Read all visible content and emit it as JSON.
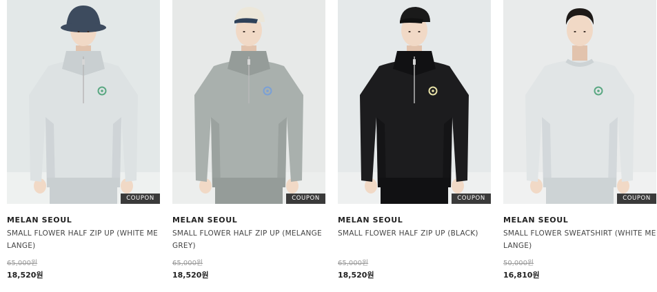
{
  "products": [
    {
      "brand": "MELAN SEOUL",
      "name": "SMALL FLOWER HALF ZIP UP (WHITE MELANGE)",
      "original_price": "65,000원",
      "sale_price": "18,520원",
      "badge": "COUPON",
      "photo": {
        "background": "#e3e8e8",
        "floor": "#eef1f0",
        "garment": "#dde2e3",
        "garment_shade": "#c9cfd1",
        "hat": "bucket",
        "hat_color": "#3d4b5e",
        "collar": "halfzip",
        "logo_color": "#5aa882"
      }
    },
    {
      "brand": "MELAN SEOUL",
      "name": "SMALL FLOWER HALF ZIP UP (MELANGE GREY)",
      "original_price": "65,000원",
      "sale_price": "18,520원",
      "badge": "COUPON",
      "photo": {
        "background": "#e7e9e8",
        "floor": "#eceeed",
        "garment": "#a9b0ad",
        "garment_shade": "#959c99",
        "hat": "cap",
        "hat_color": "#ece7da",
        "hat_brim": "#2f4159",
        "collar": "halfzip",
        "logo_color": "#7aa0d6"
      }
    },
    {
      "brand": "MELAN SEOUL",
      "name": "SMALL FLOWER HALF ZIP UP (BLACK)",
      "original_price": "65,000원",
      "sale_price": "18,520원",
      "badge": "COUPON",
      "photo": {
        "background": "#e5e9ea",
        "floor": "#eef0f0",
        "garment": "#1c1c1e",
        "garment_shade": "#111113",
        "hat": "cap",
        "hat_color": "#1a1a1a",
        "hat_brim": "#111111",
        "collar": "halfzip",
        "logo_color": "#e8e2a8"
      }
    },
    {
      "brand": "MELAN SEOUL",
      "name": "SMALL FLOWER SWEATSHIRT (WHITE MELANGE)",
      "original_price": "50,000원",
      "sale_price": "16,810원",
      "badge": "COUPON",
      "photo": {
        "background": "#e9ebeb",
        "floor": "#f0f1f1",
        "garment": "#e1e5e6",
        "garment_shade": "#cdd3d5",
        "hat": "none",
        "hair_color": "#1e1a18",
        "collar": "crew",
        "logo_color": "#5aa882"
      }
    }
  ]
}
